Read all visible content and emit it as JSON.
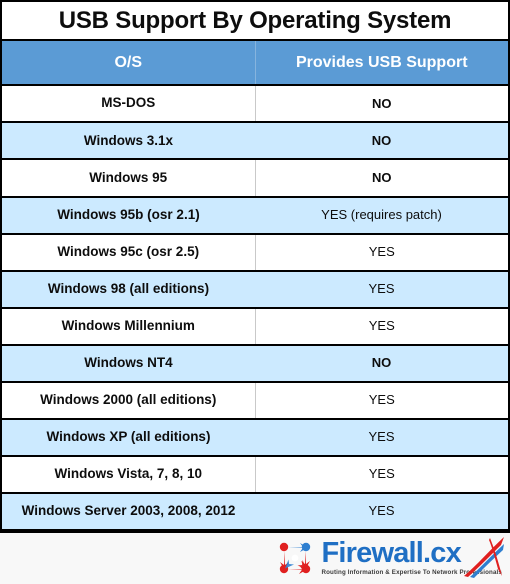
{
  "title": "USB Support By Operating System",
  "table": {
    "columns": [
      "O/S",
      "Provides USB Support"
    ],
    "rows": [
      {
        "os": "MS-DOS",
        "support": "NO",
        "bold_support": true
      },
      {
        "os": "Windows 3.1x",
        "support": "NO",
        "bold_support": true
      },
      {
        "os": "Windows 95",
        "support": "NO",
        "bold_support": true
      },
      {
        "os": "Windows 95b (osr 2.1)",
        "support": "YES (requires patch)",
        "bold_support": false
      },
      {
        "os": "Windows 95c (osr 2.5)",
        "support": "YES",
        "bold_support": false
      },
      {
        "os": "Windows 98 (all editions)",
        "support": "YES",
        "bold_support": false
      },
      {
        "os": "Windows Millennium",
        "support": "YES",
        "bold_support": false
      },
      {
        "os": "Windows NT4",
        "support": "NO",
        "bold_support": true
      },
      {
        "os": "Windows 2000 (all editions)",
        "support": "YES",
        "bold_support": false
      },
      {
        "os": "Windows XP (all editions)",
        "support": "YES",
        "bold_support": false
      },
      {
        "os": "Windows Vista, 7, 8, 10",
        "support": "YES",
        "bold_support": false
      },
      {
        "os": "Windows Server 2003, 2008, 2012",
        "support": "YES",
        "bold_support": false
      }
    ]
  },
  "logo": {
    "brand": "Firewall.cx",
    "tagline": "Routing Information & Expertise To Network Professionals",
    "mark_name": "firewall-cx-nodes-icon"
  },
  "colors": {
    "header_blue": "#5b9bd5",
    "alt_row_blue": "#cceaff",
    "white_row": "#ffffff",
    "border_black": "#000000",
    "logo_blue": "#1f6fc4",
    "logo_red": "#e02020",
    "footer_bg": "#f8f8f8"
  }
}
